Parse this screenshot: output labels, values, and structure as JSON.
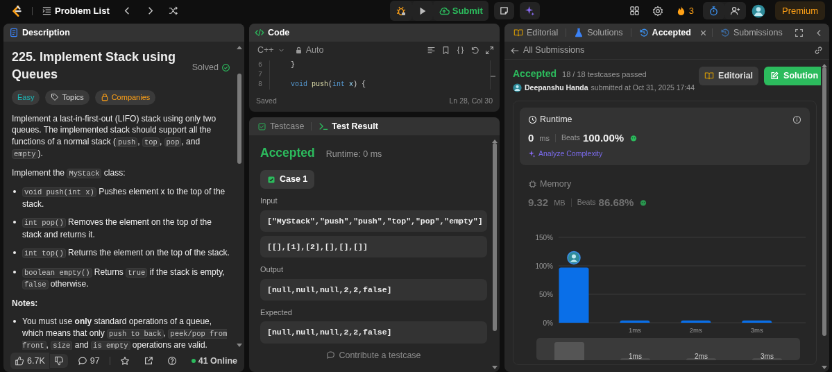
{
  "top_bar": {
    "title": "Problem List",
    "submit": "Submit",
    "streak": "3",
    "premium": "Premium"
  },
  "description_panel": {
    "tab": "Description",
    "title": "225. Implement Stack using Queues",
    "status": "Solved",
    "tags": [
      {
        "label": "Easy",
        "kind": "difficulty"
      },
      {
        "label": "Topics",
        "kind": "topics"
      },
      {
        "label": "Companies",
        "kind": "locked"
      }
    ],
    "content": [
      {
        "kind": "paragraph",
        "parts": [
          {
            "kind": "text",
            "text": "Implement a last-in-first-out (LIFO) stack using only two queues. The implemented stack should support all the functions of a normal stack ("
          },
          {
            "kind": "code",
            "text": "push"
          },
          {
            "kind": "text",
            "text": ", "
          },
          {
            "kind": "code",
            "text": "top"
          },
          {
            "kind": "text",
            "text": ", "
          },
          {
            "kind": "code",
            "text": "pop"
          },
          {
            "kind": "text",
            "text": ", and "
          },
          {
            "kind": "code",
            "text": "empty"
          },
          {
            "kind": "text",
            "text": ")."
          }
        ]
      },
      {
        "kind": "paragraph",
        "parts": [
          {
            "kind": "text",
            "text": "Implement the "
          },
          {
            "kind": "code",
            "text": "MyStack"
          },
          {
            "kind": "text",
            "text": " class:"
          }
        ]
      },
      {
        "kind": "bullet",
        "parts": [
          {
            "kind": "code",
            "text": "void push(int x)"
          },
          {
            "kind": "text",
            "text": " Pushes element x to the top of the stack."
          }
        ]
      },
      {
        "kind": "bullet",
        "parts": [
          {
            "kind": "code",
            "text": "int pop()"
          },
          {
            "kind": "text",
            "text": " Removes the element on the top of the stack and returns it."
          }
        ]
      },
      {
        "kind": "bullet",
        "parts": [
          {
            "kind": "code",
            "text": "int top()"
          },
          {
            "kind": "text",
            "text": " Returns the element on the top of the stack."
          }
        ]
      },
      {
        "kind": "bullet",
        "parts": [
          {
            "kind": "code",
            "text": "boolean empty()"
          },
          {
            "kind": "text",
            "text": " Returns "
          },
          {
            "kind": "code",
            "text": "true"
          },
          {
            "kind": "text",
            "text": " if the stack is empty, "
          },
          {
            "kind": "code",
            "text": "false"
          },
          {
            "kind": "text",
            "text": " otherwise."
          }
        ]
      },
      {
        "kind": "heading",
        "parts": [
          {
            "kind": "text",
            "text": "Notes:"
          }
        ]
      },
      {
        "kind": "bullet",
        "parts": [
          {
            "kind": "text",
            "text": "You must use "
          },
          {
            "kind": "bold",
            "text": "only"
          },
          {
            "kind": "text",
            "text": " standard operations of a queue, which means that only "
          },
          {
            "kind": "code",
            "text": "push to back"
          },
          {
            "kind": "text",
            "text": ", "
          },
          {
            "kind": "code",
            "text": "peek/pop from front"
          },
          {
            "kind": "text",
            "text": ", "
          },
          {
            "kind": "code",
            "text": "size"
          },
          {
            "kind": "text",
            "text": " and "
          },
          {
            "kind": "code",
            "text": "is empty"
          },
          {
            "kind": "text",
            "text": " operations are valid."
          }
        ]
      }
    ],
    "footer": {
      "likes": "6.7K",
      "comments": "97",
      "online": "41 Online"
    }
  },
  "code_panel": {
    "tab": "Code",
    "language": "C++",
    "mode": "Auto",
    "lines": [
      {
        "number": "6",
        "tokens": [
          {
            "kind": "plain",
            "text": "}"
          }
        ]
      },
      {
        "number": "7"
      },
      {
        "number": "8",
        "tokens": [
          {
            "kind": "keyword",
            "text": "void"
          },
          {
            "kind": "function",
            "text": "push"
          },
          {
            "kind": "plain",
            "text": "("
          },
          {
            "kind": "keyword",
            "text": "int"
          },
          {
            "kind": "param",
            "text": "x"
          },
          {
            "kind": "plain",
            "text": ") {"
          }
        ]
      }
    ],
    "status": "Saved",
    "cursor": "Ln 28, Col 30"
  },
  "test_panel": {
    "tabs": [
      {
        "label": "Testcase",
        "kind": "testcase",
        "selected": false
      },
      {
        "label": "Test Result",
        "kind": "result",
        "selected": true
      }
    ],
    "verdict": "Accepted",
    "runtime": "Runtime: 0 ms",
    "cases": [
      {
        "label": "Case 1",
        "selected": true
      }
    ],
    "sections": [
      {
        "label": "Input",
        "values": [
          "[\"MyStack\",\"push\",\"push\",\"top\",\"pop\",\"empty\"]",
          "[[],[1],[2],[],[],[]]"
        ]
      },
      {
        "label": "Output",
        "values": [
          "[null,null,null,2,2,false]"
        ]
      },
      {
        "label": "Expected",
        "values": [
          "[null,null,null,2,2,false]"
        ]
      }
    ],
    "contribute": "Contribute a testcase"
  },
  "submission_panel": {
    "tabs": [
      {
        "label": "Editorial",
        "kind": "editorial",
        "selected": false,
        "closable": false
      },
      {
        "label": "Solutions",
        "kind": "solutions",
        "selected": false,
        "closable": false
      },
      {
        "label": "Accepted",
        "kind": "accepted",
        "selected": true,
        "closable": true
      },
      {
        "label": "Submissions",
        "kind": "submissions",
        "selected": false,
        "closable": false
      }
    ],
    "back": "All Submissions",
    "verdict": "Accepted",
    "testcases": "18 / 18 testcases passed",
    "user": "Deepanshu Handa",
    "submitted": "submitted at Oct 31, 2025 17:44",
    "buttons": [
      {
        "label": "Editorial",
        "kind": "secondary"
      },
      {
        "label": "Solution",
        "kind": "primary"
      }
    ],
    "metrics": [
      {
        "kind": "runtime",
        "title": "Runtime",
        "value": "0",
        "unit": "ms",
        "beats_label": "Beats",
        "beats": "100.00%",
        "analyze": "Analyze Complexity",
        "selected": true
      },
      {
        "kind": "memory",
        "title": "Memory",
        "value": "9.32",
        "unit": "MB",
        "beats_label": "Beats",
        "beats": "86.68%",
        "selected": false
      }
    ],
    "chart_data": {
      "type": "bar",
      "x": [
        0,
        1,
        2,
        3
      ],
      "values": [
        97,
        4,
        4,
        4
      ],
      "xlim": [
        -0.25,
        3.8
      ],
      "ylim": [
        0,
        150
      ],
      "yticks": [
        {
          "value": 0,
          "label": "0%"
        },
        {
          "value": 50,
          "label": "50%"
        },
        {
          "value": 100,
          "label": "100%"
        },
        {
          "value": 150,
          "label": "150%"
        }
      ],
      "xticks": [
        {
          "value": 1,
          "label": "1ms"
        },
        {
          "value": 2,
          "label": "2ms"
        },
        {
          "value": 3,
          "label": "3ms"
        }
      ]
    },
    "navigator": {
      "labels": [
        "1ms",
        "2ms",
        "3ms"
      ]
    }
  }
}
